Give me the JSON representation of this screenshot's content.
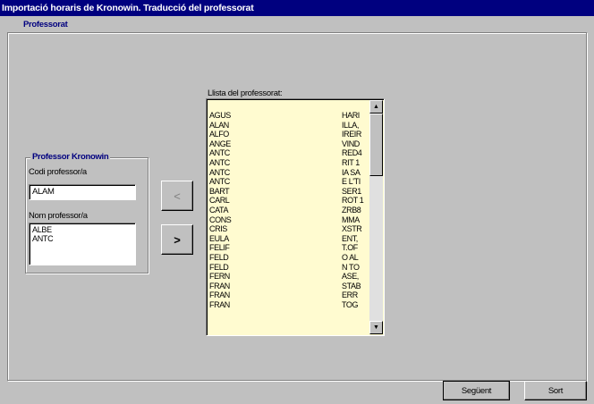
{
  "window": {
    "title": "Importació horaris de Kronowin. Traducció del professorat"
  },
  "tab": {
    "label": "Professorat"
  },
  "kronowin_group": {
    "title": "Professor Kronowin",
    "code_label": "Codi professor/a",
    "code_value": "ALAM",
    "name_label": "Nom professor/a",
    "name_items": [
      "ALBE",
      "ANTC"
    ]
  },
  "buttons": {
    "assign_left": "<",
    "assign_right": ">",
    "next": "Següent",
    "exit": "Sort"
  },
  "professorat_list": {
    "label": "Llista del professorat:",
    "rows": [
      {
        "left": "AGUS",
        "right": "HARI"
      },
      {
        "left": "ALAN",
        "right": "ILLA,"
      },
      {
        "left": "ALFO",
        "right": "IREIR"
      },
      {
        "left": "ANGE",
        "right": "VIND"
      },
      {
        "left": "ANTC",
        "right": "RED4"
      },
      {
        "left": "ANTC",
        "right": "RIT 1"
      },
      {
        "left": "ANTC",
        "right": "IA SA"
      },
      {
        "left": "ANTC",
        "right": "E L'TI"
      },
      {
        "left": "BART",
        "right": "SER1"
      },
      {
        "left": "CARL",
        "right": "ROT 1"
      },
      {
        "left": "CATA",
        "right": "ZRB8"
      },
      {
        "left": "CONS",
        "right": "MMA"
      },
      {
        "left": "CRIS",
        "right": "XSTR"
      },
      {
        "left": "EULA",
        "right": "ENT,"
      },
      {
        "left": "FELIF",
        "right": "T.OF"
      },
      {
        "left": "FELD",
        "right": "O AL"
      },
      {
        "left": "FELD",
        "right": "N TO"
      },
      {
        "left": "FERN",
        "right": "ASE,"
      },
      {
        "left": "FRAN",
        "right": "STAB"
      },
      {
        "left": "FRAN",
        "right": "ERR"
      },
      {
        "left": "FRAN",
        "right": "TOG"
      }
    ]
  },
  "scrollbar": {
    "up_icon": "arrow-up-icon",
    "down_icon": "arrow-down-icon",
    "up_glyph": "▲",
    "down_glyph": "▼"
  },
  "colors": {
    "titlebar": "#00007f",
    "window_bg": "#c0c0c0",
    "list_bg": "#fffbd0",
    "group_title": "#00007f"
  }
}
